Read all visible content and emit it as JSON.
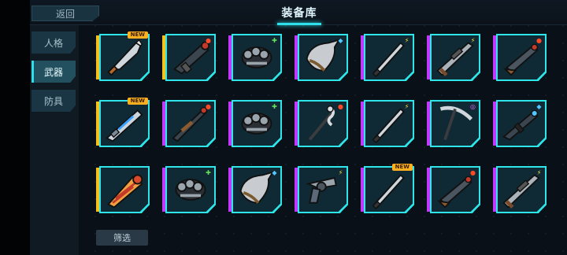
{
  "header": {
    "back_label": "返回",
    "title": "装备库"
  },
  "sidebar": {
    "tabs": [
      {
        "label": "人格",
        "active": false
      },
      {
        "label": "武器",
        "active": true
      },
      {
        "label": "防具",
        "active": false
      }
    ]
  },
  "filter_label": "筛选",
  "colors": {
    "accent": "#2ee6ea",
    "rarity_gold": "#f4c21a",
    "rarity_purple": "#c437ff"
  },
  "inventory": [
    {
      "weapon": "cleaver-sword",
      "rarity": "gold",
      "badge": "NEW",
      "element": "fire"
    },
    {
      "weapon": "rocket-launcher",
      "rarity": "gold",
      "badge": "",
      "element": "fire"
    },
    {
      "weapon": "brass-knuckles",
      "rarity": "purple",
      "badge": "",
      "element": "leaf"
    },
    {
      "weapon": "horn-shield",
      "rarity": "purple",
      "badge": "",
      "element": "water"
    },
    {
      "weapon": "dagger",
      "rarity": "purple",
      "badge": "",
      "element": "bolt"
    },
    {
      "weapon": "sniper-rifle",
      "rarity": "purple",
      "badge": "",
      "element": "bolt"
    },
    {
      "weapon": "shotgun",
      "rarity": "purple",
      "badge": "",
      "element": "fire"
    },
    {
      "weapon": "laser-rifle",
      "rarity": "gold",
      "badge": "NEW",
      "element": ""
    },
    {
      "weapon": "long-rifle",
      "rarity": "purple",
      "badge": "",
      "element": "fire"
    },
    {
      "weapon": "brass-knuckles",
      "rarity": "purple",
      "badge": "",
      "element": "leaf"
    },
    {
      "weapon": "snake-staff",
      "rarity": "purple",
      "badge": "",
      "element": "fire"
    },
    {
      "weapon": "dagger",
      "rarity": "purple",
      "badge": "",
      "element": "bolt"
    },
    {
      "weapon": "pickaxe",
      "rarity": "purple",
      "badge": "",
      "element": "spiral"
    },
    {
      "weapon": "assault-rifle",
      "rarity": "purple",
      "badge": "",
      "element": "water"
    },
    {
      "weapon": "drill-cone",
      "rarity": "gold",
      "badge": "",
      "element": ""
    },
    {
      "weapon": "brass-knuckles",
      "rarity": "purple",
      "badge": "",
      "element": "leaf"
    },
    {
      "weapon": "horn-shield",
      "rarity": "purple",
      "badge": "",
      "element": "water"
    },
    {
      "weapon": "revolver",
      "rarity": "purple",
      "badge": "",
      "element": "bolt"
    },
    {
      "weapon": "dagger",
      "rarity": "purple",
      "badge": "NEW",
      "element": ""
    },
    {
      "weapon": "shotgun",
      "rarity": "purple",
      "badge": "",
      "element": "fire"
    },
    {
      "weapon": "sniper-rifle",
      "rarity": "purple",
      "badge": "",
      "element": "bolt"
    }
  ]
}
